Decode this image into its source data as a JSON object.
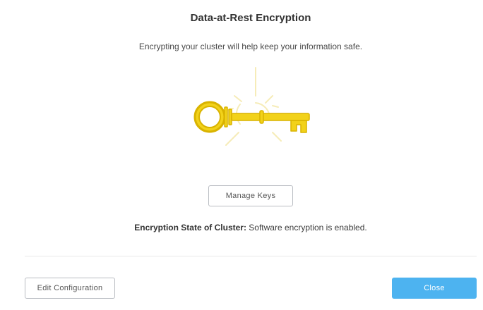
{
  "dialog": {
    "title": "Data-at-Rest Encryption",
    "subtitle": "Encrypting your cluster will help keep your information safe.",
    "illustration_icon": "key-icon",
    "manage_keys_label": "Manage Keys",
    "state_label": "Encryption State of Cluster:",
    "state_value": " Software encryption is enabled.",
    "edit_configuration_label": "Edit Configuration",
    "close_label": "Close"
  },
  "colors": {
    "accent": "#4db3f0",
    "key_gold": "#f2d21a",
    "key_outline": "#d9b300",
    "sparkle": "#f6ecb8"
  }
}
